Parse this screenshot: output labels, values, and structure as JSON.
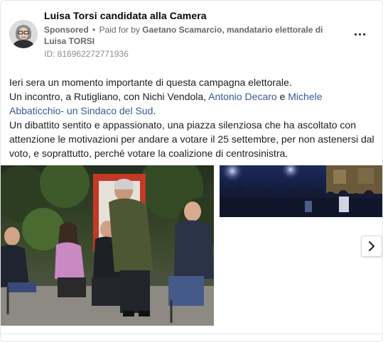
{
  "post": {
    "page_name": "Luisa Torsi candidata alla Camera",
    "sponsored_label": "Sponsored",
    "separator": "•",
    "paid_for_prefix": "Paid for by",
    "paid_for_name": "Gaetano Scamarcio, mandatario elettorale di Luisa TORSI",
    "library_id": "ID: 816962272771936",
    "text": {
      "line1": "Ieri sera un momento importante di questa campagna elettorale.",
      "line2_a": "Un incontro, a Rutigliano, con Nichi Vendola, ",
      "line2_link1": "Antonio Decaro",
      "line2_b": " e ",
      "line2_link2": "Michele Abbaticchio- un Sindaco del Sud",
      "line2_c": ".",
      "line3": "Un dibattito sentito e appassionato, una piazza silenziosa che ha ascoltato con attenzione le motivazioni per andare a votare il 25 settembre, per non astenersi dal voto, e soprattutto, perché votare la coalizione di centrosinistra."
    }
  },
  "media": {
    "image_count": 2,
    "next_button_icon": "chevron-right-icon"
  },
  "colors": {
    "link": "#385898",
    "meta": "#65676b",
    "text": "#1c1e21"
  }
}
